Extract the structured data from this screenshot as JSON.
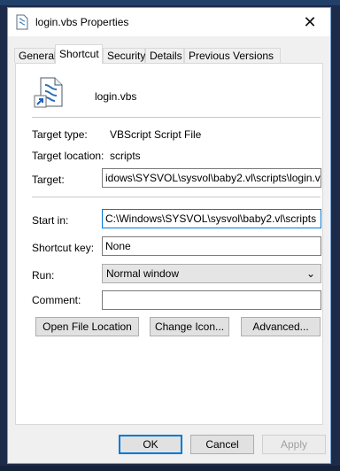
{
  "window": {
    "title": "login.vbs Properties",
    "close_symbol": "✕"
  },
  "tabs": [
    {
      "label": "General",
      "active": false
    },
    {
      "label": "Shortcut",
      "active": true
    },
    {
      "label": "Security",
      "active": false
    },
    {
      "label": "Details",
      "active": false
    },
    {
      "label": "Previous Versions",
      "active": false
    }
  ],
  "shortcut": {
    "file_name": "login.vbs",
    "target_type_label": "Target type:",
    "target_type_value": "VBScript Script File",
    "target_location_label": "Target location:",
    "target_location_value": "scripts",
    "target_label": "Target:",
    "target_value": "idows\\SYSVOL\\sysvol\\baby2.vl\\scripts\\login.vbs",
    "start_in_label": "Start in:",
    "start_in_value": "C:\\Windows\\SYSVOL\\sysvol\\baby2.vl\\scripts",
    "shortcut_key_label": "Shortcut key:",
    "shortcut_key_value": "None",
    "run_label": "Run:",
    "run_value": "Normal window",
    "comment_label": "Comment:",
    "comment_value": ""
  },
  "panel_buttons": {
    "open_file_location": "Open File Location",
    "change_icon": "Change Icon...",
    "advanced": "Advanced..."
  },
  "footer": {
    "ok": "OK",
    "cancel": "Cancel",
    "apply": "Apply"
  },
  "colors": {
    "focus_border": "#0078d7",
    "desktop": "#1c2b4a"
  }
}
